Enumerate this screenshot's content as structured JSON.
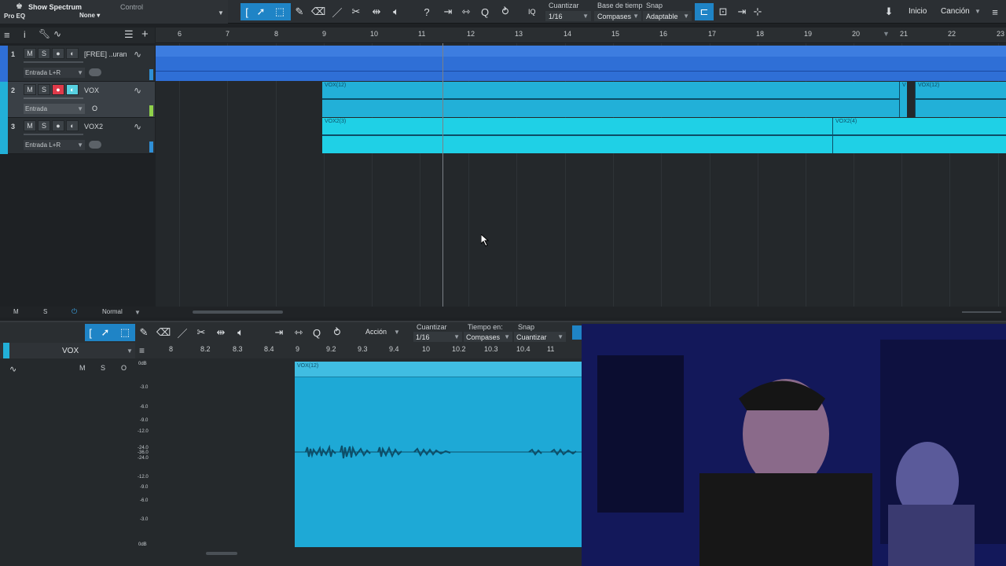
{
  "toolbar": {
    "plugin_title": "Show Spectrum",
    "plugin_name": "Pro EQ",
    "preset_value": "None",
    "control_label": "Control",
    "quantize_label": "Cuantizar",
    "quantize_value": "1/16",
    "timebase_label": "Base de tiemp",
    "timebase_value": "Compases",
    "snap_label": "Snap",
    "snap_value": "Adaptable",
    "iq_label": "IQ",
    "inicio": "Inicio",
    "cancion": "Canción"
  },
  "tracks": [
    {
      "num": "1",
      "name": "[FREE] ..uran",
      "input": "Entrada L+R",
      "color": "#2f6fd6"
    },
    {
      "num": "2",
      "name": "VOX",
      "input": "Entrada",
      "color": "#22b0d8"
    },
    {
      "num": "3",
      "name": "VOX2",
      "input": "Entrada L+R",
      "color": "#22b0d8"
    }
  ],
  "track_buttons": {
    "mute": "M",
    "solo": "S"
  },
  "ruler_marks": [
    "6",
    "7",
    "8",
    "9",
    "10",
    "11",
    "12",
    "13",
    "14",
    "15",
    "16",
    "17",
    "18",
    "19",
    "20",
    "21",
    "22",
    "23"
  ],
  "events": {
    "vox_a": "VOX(12)",
    "vox_b": "VOX(12)",
    "vox2_a": "VOX2(3)",
    "vox2_b": "VOX2(4)",
    "vox_small": "V"
  },
  "arrange_footer": {
    "m": "M",
    "s": "S",
    "mode": "Normal"
  },
  "editor": {
    "action": "Acción",
    "quantize_label": "Cuantizar",
    "quantize_value": "1/16",
    "time_label": "Tiempo en:",
    "time_value": "Compases",
    "snap_label": "Snap",
    "snap_value": "Cuantizar",
    "track_name": "VOX",
    "m": "M",
    "s": "S",
    "o": "O",
    "event_label": "VOX(12)",
    "ruler": [
      "8",
      "8.2",
      "8.3",
      "8.4",
      "9",
      "9.2",
      "9.3",
      "9.4",
      "10",
      "10.2",
      "10.3",
      "10.4",
      "11"
    ],
    "db_scale": [
      "0dB",
      "-3.0",
      "-6.0",
      "-9.0",
      "-12.0",
      "-24.0",
      "-36.0",
      "-24.0",
      "-12.0",
      "-9.0",
      "-6.0",
      "-3.0",
      "0dB"
    ]
  },
  "colors": {
    "accent": "#1f84c6",
    "event_blue": "#22b0d8",
    "event_cyan": "#1fd0e6",
    "track1": "#2f6fd6",
    "record": "#e03a4a"
  }
}
